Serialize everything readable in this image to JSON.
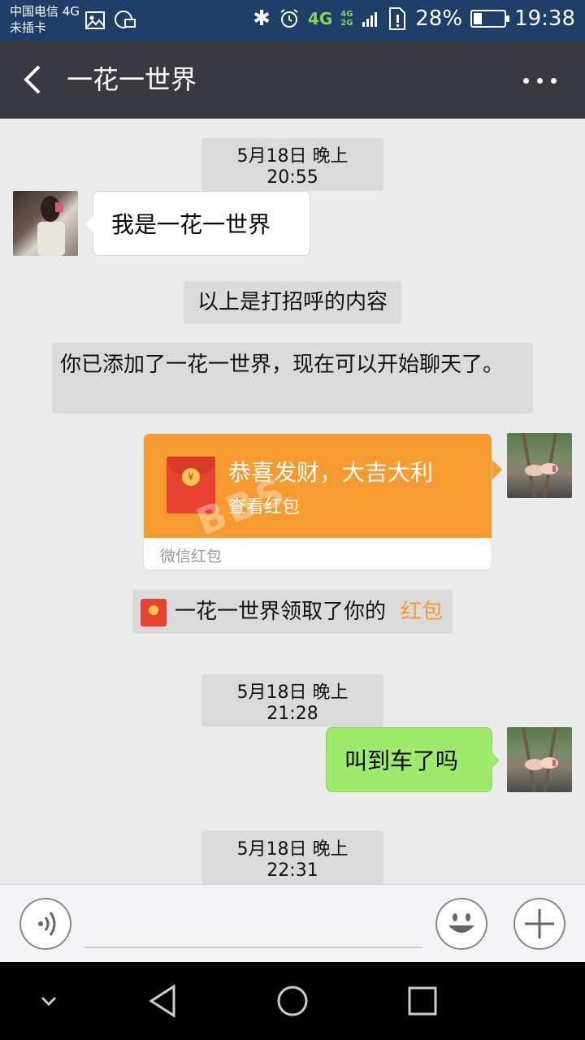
{
  "status_bar": {
    "carrier_line1": "中国电信 4G",
    "carrier_line2": "未插卡",
    "network": "4G",
    "network_small": "4G 2G",
    "battery": "28%",
    "battery_level": 0.28,
    "time": "19:38"
  },
  "title_bar": {
    "title": "一花一世界"
  },
  "chat": {
    "ts1": "5月18日 晚上20:55",
    "msg1": "我是一花一世界",
    "greet_note": "以上是打招呼的内容",
    "added_note": "你已添加了一花一世界，现在可以开始聊天了。",
    "redpacket": {
      "title": "恭喜发财，大吉大利",
      "subtitle": "查看红包",
      "footer": "微信红包"
    },
    "claimed_prefix": "一花一世界领取了你的",
    "claimed_link": "红包",
    "claimed_link_color": "#f79b30",
    "ts2": "5月18日 晚上21:28",
    "msg2": "叫到车了吗",
    "ts3": "5月18日 晚上22:31"
  },
  "watermark": "BBS",
  "colors": {
    "status_bar": "#1f3f6a",
    "title_bar": "#393a3f",
    "sent_bubble": "#9eea6a",
    "redpacket": "#f79b30"
  }
}
